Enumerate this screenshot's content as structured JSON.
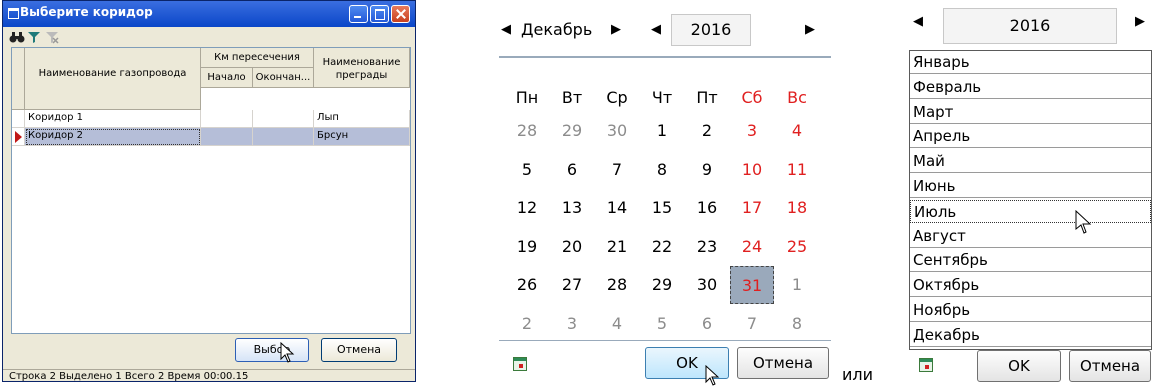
{
  "dialog": {
    "title": "Выберите коридор",
    "columns": {
      "name": "Наименование газопровода",
      "km_group": "Км пересечения",
      "km_start": "Начало",
      "km_end": "Окончан...",
      "barrier": "Наименование преграды"
    },
    "rows": [
      {
        "name": "Коридор 1",
        "start": "",
        "end": "",
        "barrier": "Лып"
      },
      {
        "name": "Коридор 2",
        "start": "",
        "end": "",
        "barrier": "Брсун"
      }
    ],
    "select_label": "Выбор",
    "cancel_label": "Отмена",
    "status": "Строка 2 Выделено 1 Всего 2 Время 00:00.15"
  },
  "calendar": {
    "month": "Декабрь",
    "year": "2016",
    "weekdays": [
      "Пн",
      "Вт",
      "Ср",
      "Чт",
      "Пт",
      "Сб",
      "Вс"
    ],
    "weeks": [
      [
        "28",
        "29",
        "30",
        "1",
        "2",
        "3",
        "4"
      ],
      [
        "5",
        "6",
        "7",
        "8",
        "9",
        "10",
        "11"
      ],
      [
        "12",
        "13",
        "14",
        "15",
        "16",
        "17",
        "18"
      ],
      [
        "19",
        "20",
        "21",
        "22",
        "23",
        "24",
        "25"
      ],
      [
        "26",
        "27",
        "28",
        "29",
        "30",
        "31",
        "1"
      ],
      [
        "2",
        "3",
        "4",
        "5",
        "6",
        "7",
        "8"
      ]
    ],
    "selected": "31",
    "ok_label": "OK",
    "cancel_label": "Отмена"
  },
  "or_label": "или",
  "month_picker": {
    "year": "2016",
    "months": [
      "Январь",
      "Февраль",
      "Март",
      "Апрель",
      "Май",
      "Июнь",
      "Июль",
      "Август",
      "Сентябрь",
      "Октябрь",
      "Ноябрь",
      "Декабрь"
    ],
    "highlighted": "Июль",
    "ok_label": "OK",
    "cancel_label": "Отмена"
  },
  "colors": {
    "weekend": "#e02020",
    "title_bar": "#0a46c8",
    "selection": "#b5bed8"
  },
  "icons": [
    "binoculars-icon",
    "filter-icon",
    "clear-filter-icon",
    "row-pointer-icon",
    "calendar-today-icon",
    "cursor-icon",
    "nav-left-icon",
    "nav-right-icon"
  ]
}
